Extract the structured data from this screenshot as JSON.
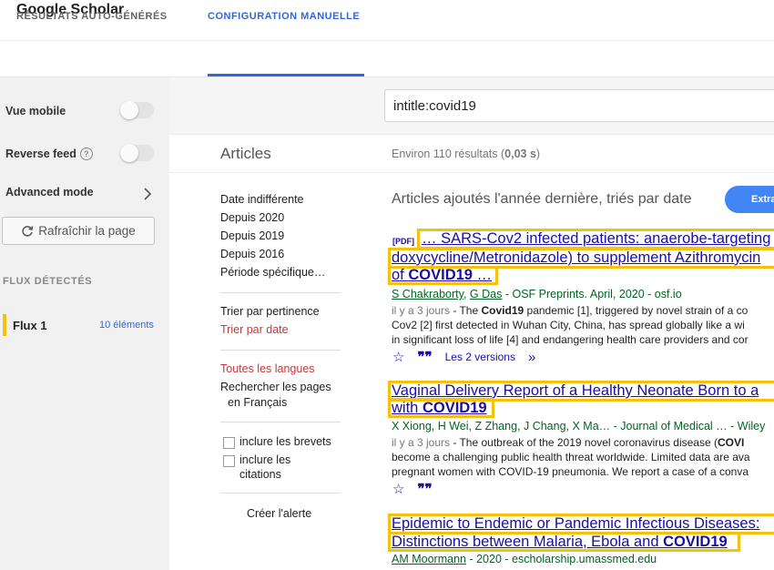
{
  "app": {
    "title": "Google Scholar"
  },
  "tabs": [
    {
      "label": "RÉSULTATS AUTO-GÉNÉRÉS"
    },
    {
      "label": "CONFIGURATION MANUELLE"
    }
  ],
  "sidebar": {
    "mobile_label": "Vue mobile",
    "reverse_label": "Reverse feed",
    "help_glyph": "?",
    "advanced_label": "Advanced mode",
    "refresh_label": "Rafraîchir la page",
    "flux_header": "FLUX DÉTECTÉS",
    "flux_name": "Flux 1",
    "flux_count": "10 éléments",
    "accent": "#f4c20d"
  },
  "search": {
    "query": "intitle:covid19"
  },
  "main": {
    "articles_heading": "Articles",
    "results_prefix": "Environ 110 résultats (",
    "results_time": "0,03 s",
    "results_suffix": ")",
    "sort_heading": "Articles ajoutés l'année dernière, triés par date",
    "extra_button": "Extra"
  },
  "filters": {
    "any_time": "Date indifférente",
    "since_2020": "Depuis 2020",
    "since_2019": "Depuis 2019",
    "since_2016": "Depuis 2016",
    "custom_range": "Période spécifique…",
    "sort_relevance": "Trier par pertinence",
    "sort_date": "Trier par date",
    "all_languages": "Toutes les langues",
    "french_pages_1": "Rechercher les pages",
    "french_pages_2": "en Français",
    "include_patents": "inclure les brevets",
    "include_citations_1": "inclure les",
    "include_citations_2": "citations",
    "create_alert": "Créer l'alerte"
  },
  "results": [
    {
      "pdf_tag": "[PDF]",
      "title_line1": "… SARS-Cov2 infected patients: anaerobe-targeting",
      "title_line2": "doxycycline/Metronidazole) to supplement Azithromycin",
      "title_line3_prefix": "of ",
      "title_line3_bold": "COVID19",
      "title_line3_suffix": " …",
      "author1": "S Chakraborty",
      "author_sep": ", ",
      "author2": "G Das",
      "source": " - OSF Preprints. April, 2020 - osf.io",
      "snippet_date": "il y a 3 jours",
      "snippet_line1_a": " - The ",
      "snippet_line1_bold": "Covid19",
      "snippet_line1_b": " pandemic [1], triggered by novel strain of a co",
      "snippet_line2": "Cov2 [2] first detected in Wuhan City, China, has spread globally like a wi",
      "snippet_line3": "in significant loss of life [4] and endangering health care providers and cor",
      "versions": "Les 2 versions"
    },
    {
      "title_line1": "Vaginal Delivery Report of a Healthy Neonate Born to a",
      "title_line2_prefix": "with ",
      "title_line2_bold": "COVID19",
      "authors": "X Xiong, H Wei, Z Zhang, J Chang, X Ma…",
      "source": " - Journal of Medical … - Wiley",
      "snippet_date": "il y a 3 jours",
      "snippet_line1": " - The outbreak of the 2019 novel coronavirus disease (",
      "snippet_line1_bold": "COVI",
      "snippet_line2": "become a challenging public health threat worldwide. Limited data are ava",
      "snippet_line3": "pregnant women with COVID-19 pneumonia. We report a case of a conva"
    },
    {
      "title_line1": "Epidemic to Endemic or Pandemic Infectious Diseases:",
      "title_line2_prefix": "Distinctions between Malaria, Ebola and ",
      "title_line2_bold": "COVID19",
      "author1": "AM Moormann",
      "source": " - 2020 - escholarship.umassmed.edu"
    }
  ]
}
